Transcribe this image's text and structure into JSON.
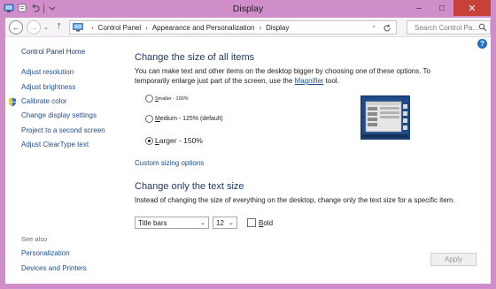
{
  "window": {
    "title": "Display",
    "controls": {
      "minimize": "–",
      "maximize": "□",
      "close": "✕"
    },
    "accent": "#cf8ec9"
  },
  "nav": {
    "back_glyph": "←",
    "forward_glyph": "→",
    "up_glyph": "↑",
    "breadcrumbs": [
      "Control Panel",
      "Appearance and Personalization",
      "Display"
    ],
    "separator": "›",
    "search_placeholder": "Search Control Pa..."
  },
  "sidebar": {
    "home": "Control Panel Home",
    "items": [
      {
        "label": "Adjust resolution"
      },
      {
        "label": "Adjust brightness"
      },
      {
        "label": "Calibrate color",
        "icon": "shield-icon"
      },
      {
        "label": "Change display settings"
      },
      {
        "label": "Project to a second screen"
      },
      {
        "label": "Adjust ClearType text"
      }
    ],
    "see_also_label": "See also",
    "see_also": [
      {
        "label": "Personalization"
      },
      {
        "label": "Devices and Printers"
      }
    ]
  },
  "main": {
    "help_glyph": "?",
    "section1": {
      "title": "Change the size of all items",
      "description_before_link": "You can make text and other items on the desktop bigger by choosing one of these options. To temporarily enlarge just part of the screen, use the ",
      "description_link": "Magnifier",
      "description_after_link": " tool.",
      "options": [
        {
          "access_key": "S",
          "rest": "maller - 100%",
          "selected": false
        },
        {
          "access_key": "M",
          "rest": "edium - 125% (default)",
          "selected": false
        },
        {
          "access_key": "L",
          "rest": "arger - 150%",
          "selected": true
        }
      ],
      "custom_link": "Custom sizing options"
    },
    "section2": {
      "title": "Change only the text size",
      "description": "Instead of changing the size of everything on the desktop, change only the text size for a specific item.",
      "item_select": "Title bars",
      "size_select": "12",
      "bold_access_key": "B",
      "bold_rest": "old",
      "bold_checked": false,
      "dropdown_glyph": "⌄"
    },
    "apply_label": "Apply"
  }
}
